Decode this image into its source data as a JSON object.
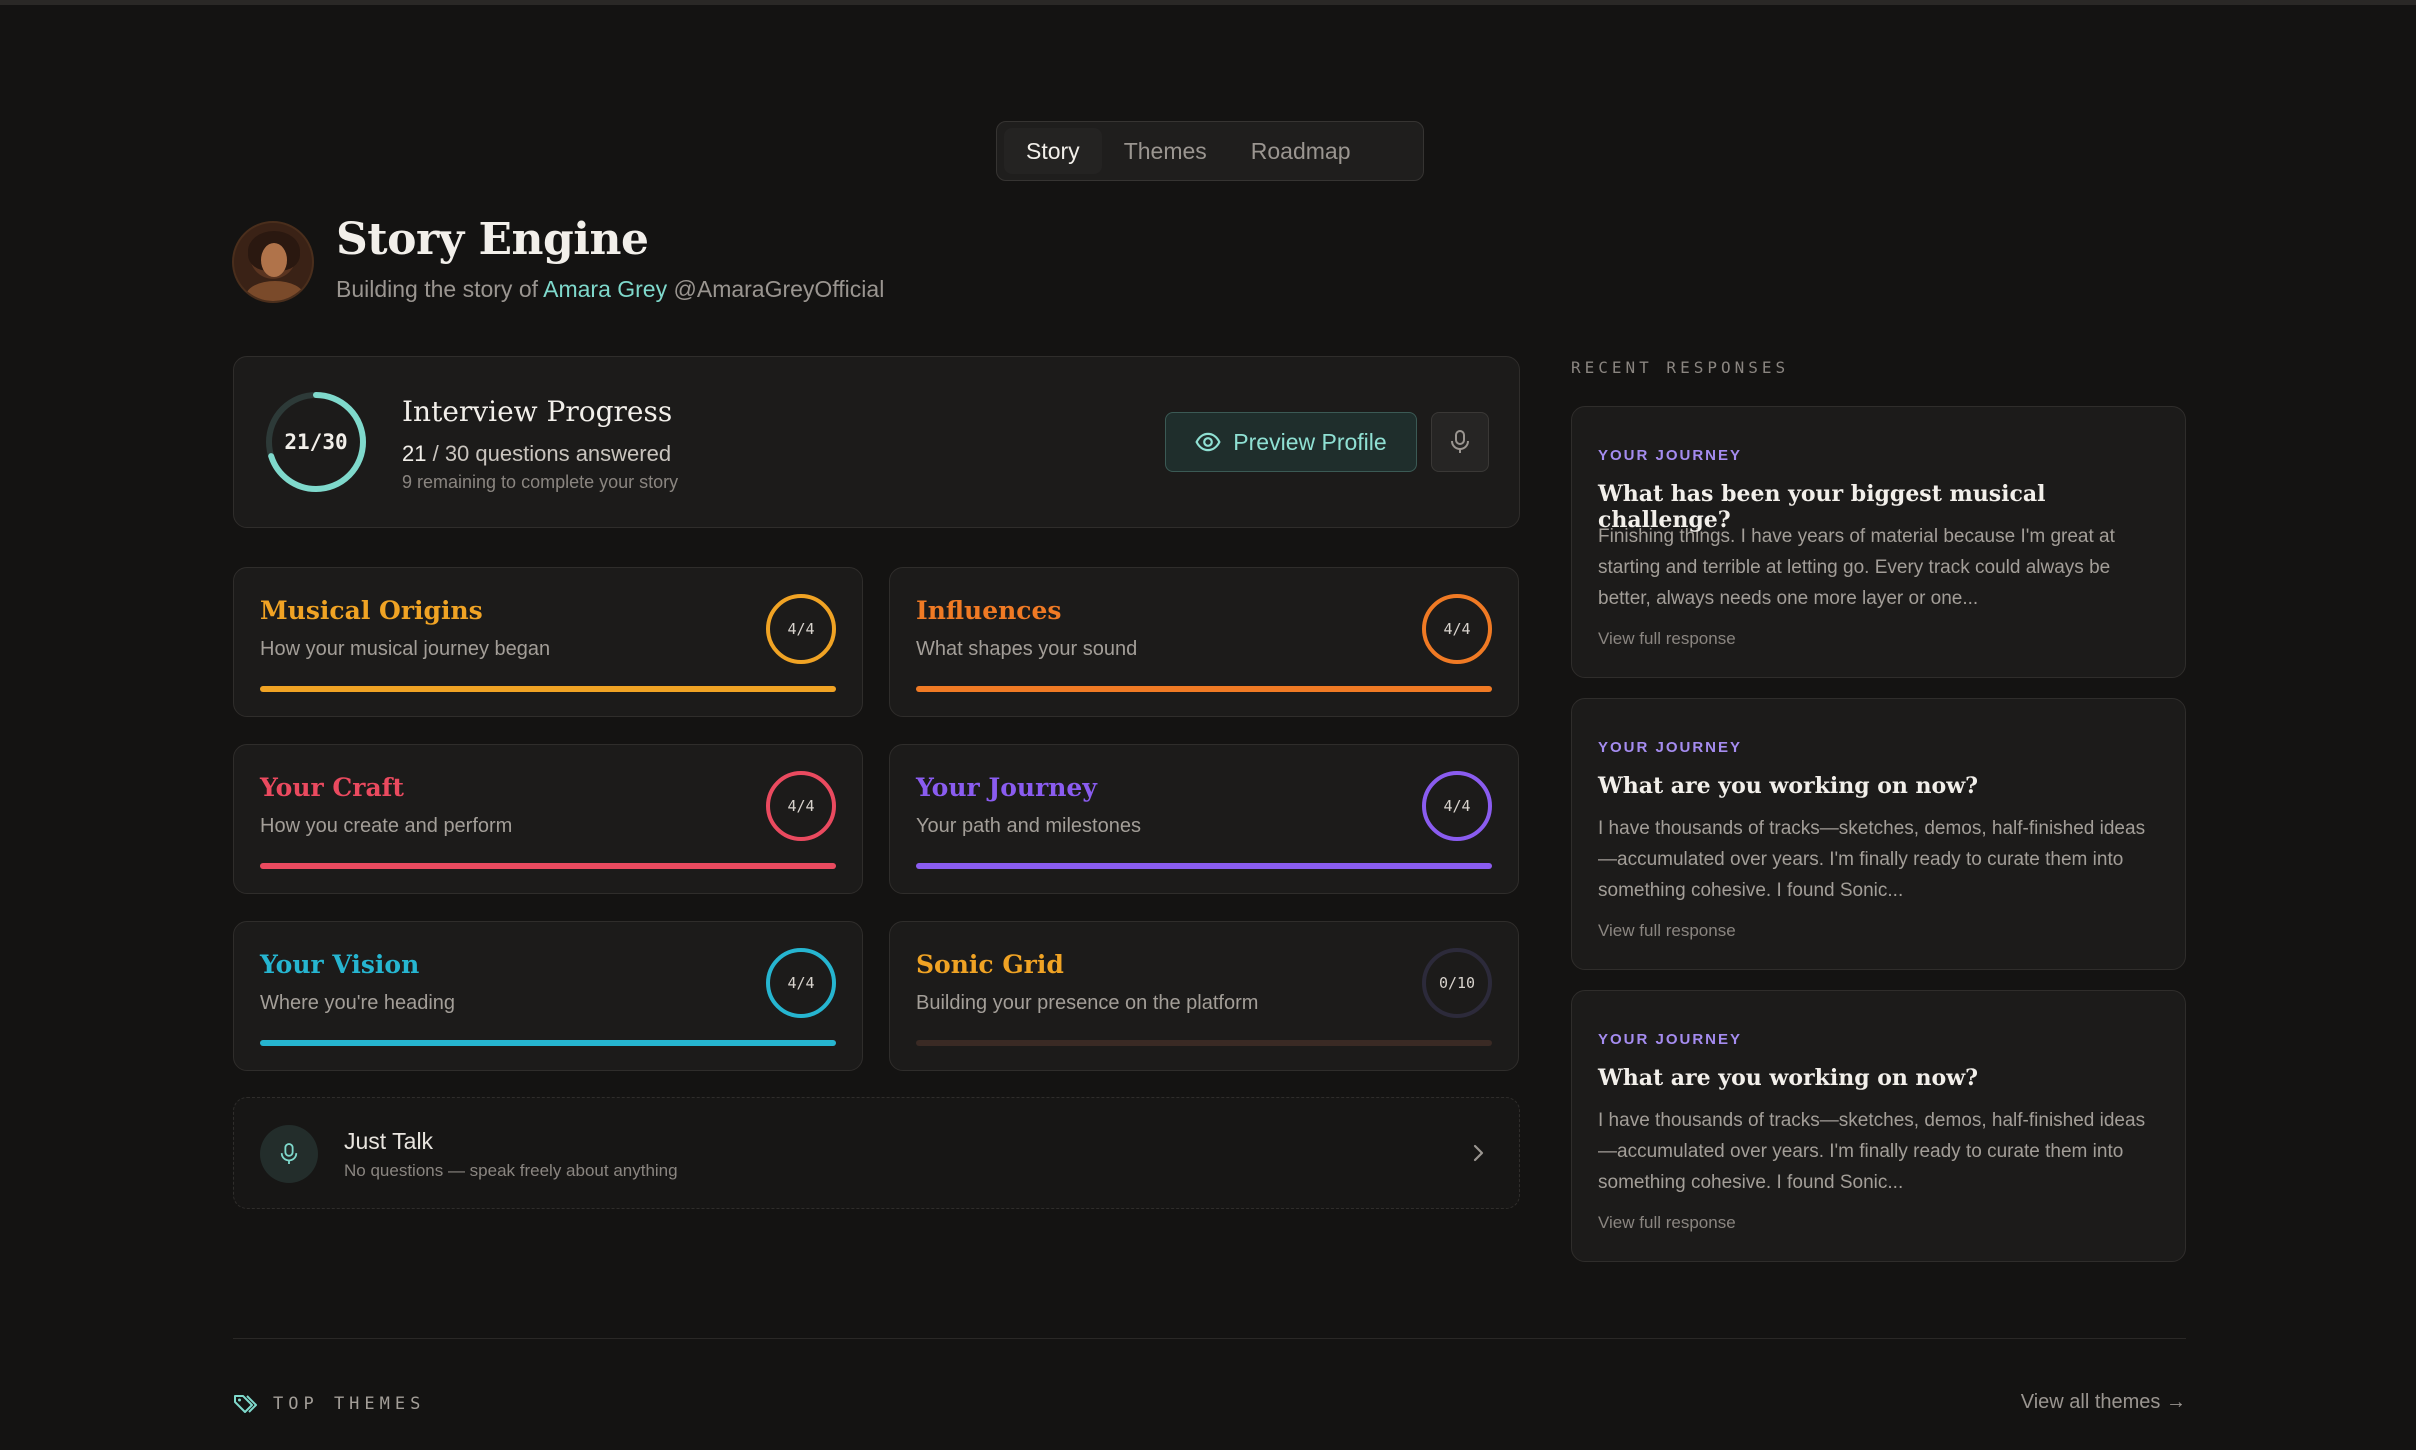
{
  "tabs": [
    {
      "label": "Story",
      "active": true
    },
    {
      "label": "Themes",
      "active": false
    },
    {
      "label": "Roadmap",
      "active": false
    }
  ],
  "header": {
    "title": "Story Engine",
    "subtitle_prefix": "Building the story of ",
    "artist_name": "Amara Grey",
    "handle": " @AmaraGreyOfficial"
  },
  "progress": {
    "ring_label": "21/30",
    "answered": 21,
    "total": 30,
    "title": "Interview Progress",
    "answered_text": "21",
    "answered_suffix": " / 30 questions answered",
    "remaining_text": "9 remaining to complete your story",
    "preview_label": "Preview Profile",
    "accent": "#7fd9cc"
  },
  "themes": [
    {
      "name": "Musical Origins",
      "desc": "How your musical journey began",
      "count": "4/4",
      "fraction": 1.0,
      "color": "#f0a324"
    },
    {
      "name": "Influences",
      "desc": "What shapes your sound",
      "count": "4/4",
      "fraction": 1.0,
      "color": "#f07a24"
    },
    {
      "name": "Your Craft",
      "desc": "How you create and perform",
      "count": "4/4",
      "fraction": 1.0,
      "color": "#ea4a5f"
    },
    {
      "name": "Your Journey",
      "desc": "Your path and milestones",
      "count": "4/4",
      "fraction": 1.0,
      "color": "#8a5cf0"
    },
    {
      "name": "Your Vision",
      "desc": "Where you're heading",
      "count": "4/4",
      "fraction": 1.0,
      "color": "#26b5d0"
    },
    {
      "name": "Sonic Grid",
      "desc": "Building your presence on the platform",
      "count": "0/10",
      "fraction": 0.0,
      "color": "#f0a324"
    }
  ],
  "just_talk": {
    "title": "Just Talk",
    "subtitle": "No questions — speak freely about anything"
  },
  "recent": {
    "heading": "RECENT RESPONSES",
    "items": [
      {
        "tag": "YOUR JOURNEY",
        "question": "What has been your biggest musical challenge?",
        "answer": "Finishing things. I have years of material because I'm great at starting and terrible at letting go. Every track could always be better, always needs one more layer or one...",
        "link": "View full response"
      },
      {
        "tag": "YOUR JOURNEY",
        "question": "What are you working on now?",
        "answer": "I have thousands of tracks—sketches, demos, half-finished ideas—accumulated over years. I'm finally ready to curate them into something cohesive. I found Sonic...",
        "link": "View full response"
      },
      {
        "tag": "YOUR JOURNEY",
        "question": "What are you working on now?",
        "answer": "I have thousands of tracks—sketches, demos, half-finished ideas—accumulated over years. I'm finally ready to curate them into something cohesive. I found Sonic...",
        "link": "View full response"
      }
    ]
  },
  "footer": {
    "top_themes": "TOP THEMES",
    "view_all": "View all themes →"
  }
}
